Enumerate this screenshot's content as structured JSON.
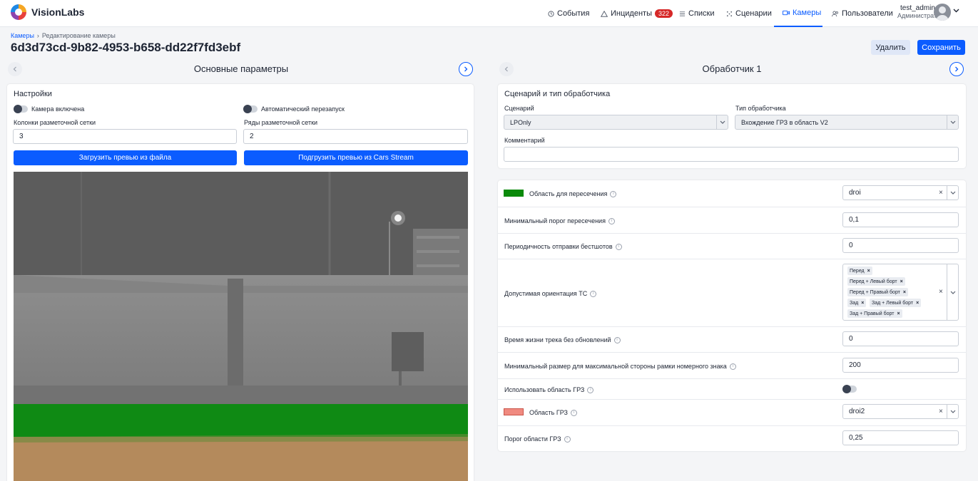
{
  "app": {
    "name": "VisionLabs"
  },
  "nav": [
    {
      "label": "События",
      "icon": "clock-icon"
    },
    {
      "label": "Инциденты",
      "icon": "warning-icon",
      "badge": "322"
    },
    {
      "label": "Списки",
      "icon": "list-icon"
    },
    {
      "label": "Сценарии",
      "icon": "scenario-icon"
    },
    {
      "label": "Камеры",
      "icon": "camera-icon",
      "active": true
    },
    {
      "label": "Пользователи",
      "icon": "users-icon"
    }
  ],
  "user": {
    "name": "test_admin",
    "role": "Администратор"
  },
  "breadcrumb": {
    "root": "Камеры",
    "current": "Редактирование камеры"
  },
  "page": {
    "title": "6d3d73cd-9b82-4953-b658-dd22f7fd3ebf"
  },
  "actions": {
    "delete": "Удалить",
    "save": "Сохранить"
  },
  "left": {
    "pager_title": "Основные параметры",
    "settings": {
      "title": "Настройки",
      "camera_enabled_label": "Камера включена",
      "auto_restart_label": "Автоматический перезапуск",
      "grid_columns_label": "Колонки разметочной сетки",
      "grid_columns_value": "3",
      "grid_rows_label": "Ряды разметочной сетки",
      "grid_rows_value": "2",
      "upload_file_button": "Загрузить превью из файла",
      "upload_stream_button": "Подгрузить превью из Cars Stream"
    }
  },
  "right": {
    "pager_title": "Обработчик 1",
    "scenario": {
      "title": "Сценарий и тип обработчика",
      "scenario_label": "Сценарий",
      "scenario_value": "LPOnly",
      "handler_type_label": "Тип обработчика",
      "handler_type_value": "Вхождение ГРЗ в область V2",
      "comment_label": "Комментарий",
      "comment_value": ""
    },
    "params": {
      "intersection_area": {
        "label": "Область для пересечения",
        "value": "droi",
        "color": "#0a8a0a"
      },
      "min_threshold": {
        "label": "Минимальный порог пересечения",
        "value": "0,1"
      },
      "bestshot_period": {
        "label": "Периодичность отправки бестшотов",
        "value": "0"
      },
      "orientation": {
        "label": "Допустимая ориентация ТС",
        "chips": [
          "Перед",
          "Перед + Левый борт",
          "Перед + Правый борт",
          "Зад",
          "Зад + Левый борт",
          "Зад + Правый борт"
        ]
      },
      "track_lifetime": {
        "label": "Время жизни трека без обновлений",
        "value": "0"
      },
      "min_plate_size": {
        "label": "Минимальный размер для максимальной стороны рамки номерного знака",
        "value": "200"
      },
      "use_plate_area": {
        "label": "Использовать область ГРЗ"
      },
      "plate_area": {
        "label": "Область ГРЗ",
        "value": "droi2",
        "color": "#f08a80"
      },
      "plate_threshold": {
        "label": "Порог области ГРЗ",
        "value": "0,25"
      }
    }
  }
}
